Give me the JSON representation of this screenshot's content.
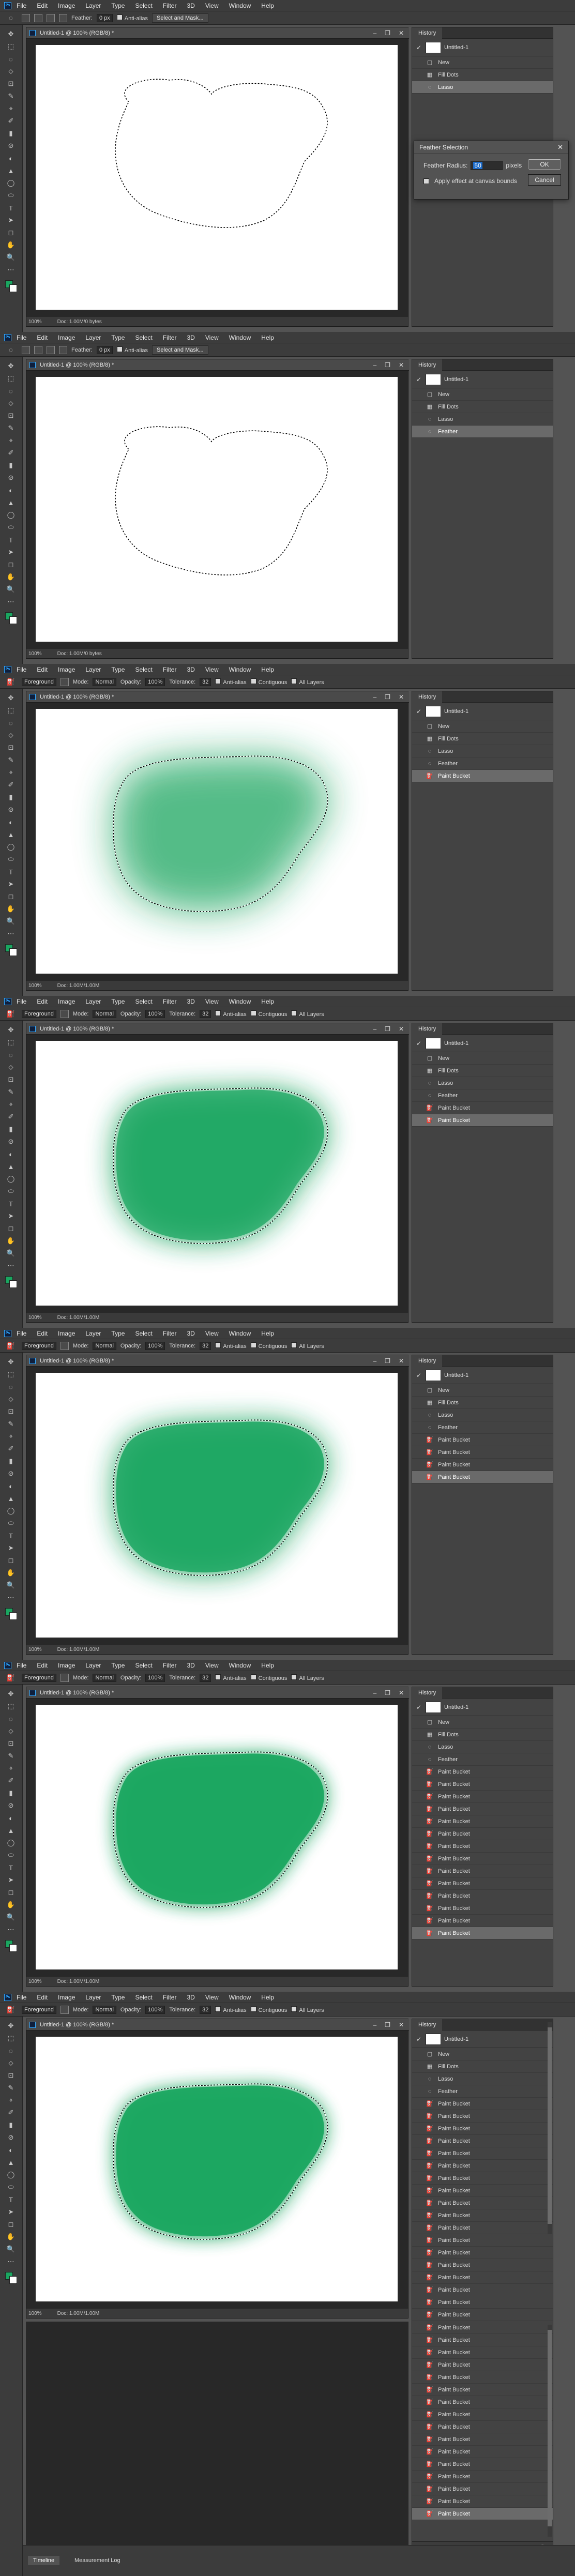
{
  "menu": [
    "File",
    "Edit",
    "Image",
    "Layer",
    "Type",
    "Select",
    "Filter",
    "3D",
    "View",
    "Window",
    "Help"
  ],
  "options_lasso": {
    "feather_label": "Feather:",
    "feather_value": "0 px",
    "anti_alias": "Anti-alias",
    "select_mask": "Select and Mask..."
  },
  "options_bucket": {
    "fill_source": "Foreground",
    "mode_label": "Mode:",
    "mode_value": "Normal",
    "opacity_label": "Opacity:",
    "opacity_value": "100%",
    "tolerance_label": "Tolerance:",
    "tolerance_value": "32",
    "anti_alias": "Anti-alias",
    "contiguous": "Contiguous",
    "all_layers": "All Layers"
  },
  "document": {
    "tab_title": "Untitled-1 @ 100% (RGB/8) *",
    "zoom": "100%",
    "doc_size": "Doc: 1.00M/0 bytes",
    "doc_size_filled": "Doc: 1.00M/1.00M"
  },
  "history": {
    "tab": "History",
    "snapshot": "Untitled-1",
    "base_items": [
      "New",
      "Fill Dots",
      "Lasso"
    ],
    "feather": "Feather",
    "paint_bucket": "Paint Bucket"
  },
  "dialog": {
    "title": "Feather Selection",
    "radius_label": "Feather Radius:",
    "radius_value": "50",
    "unit": "pixels",
    "apply_label": "Apply effect at canvas bounds",
    "ok": "OK",
    "cancel": "Cancel"
  },
  "bottom_tabs": [
    "Timeline",
    "Measurement Log"
  ],
  "colors": {
    "fill_green": "#1aa660",
    "ui_dark": "#535353",
    "panel": "#434343",
    "selection_highlight": "#1c6bc9"
  }
}
